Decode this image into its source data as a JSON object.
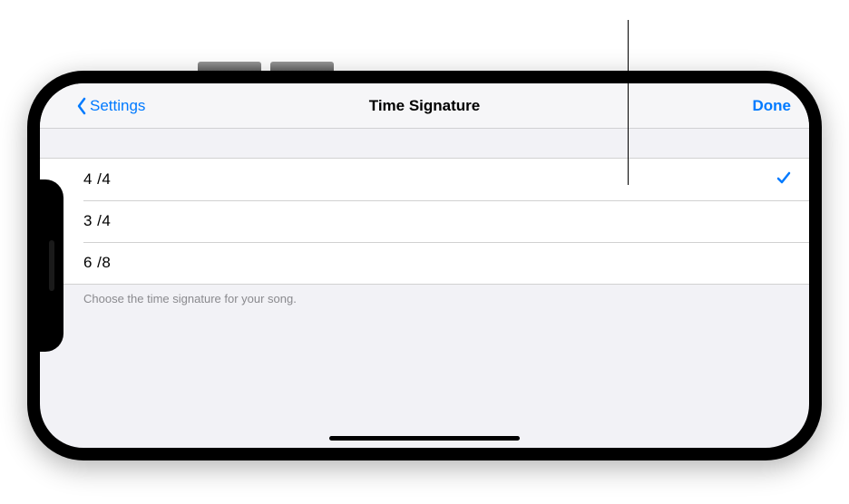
{
  "nav": {
    "back_label": "Settings",
    "title": "Time Signature",
    "done_label": "Done"
  },
  "options": [
    {
      "label": "4 /4",
      "selected": true
    },
    {
      "label": "3 /4",
      "selected": false
    },
    {
      "label": "6 /8",
      "selected": false
    }
  ],
  "footer": "Choose the time signature for your song.",
  "colors": {
    "accent": "#007aff",
    "grouped_bg": "#f2f2f6"
  }
}
